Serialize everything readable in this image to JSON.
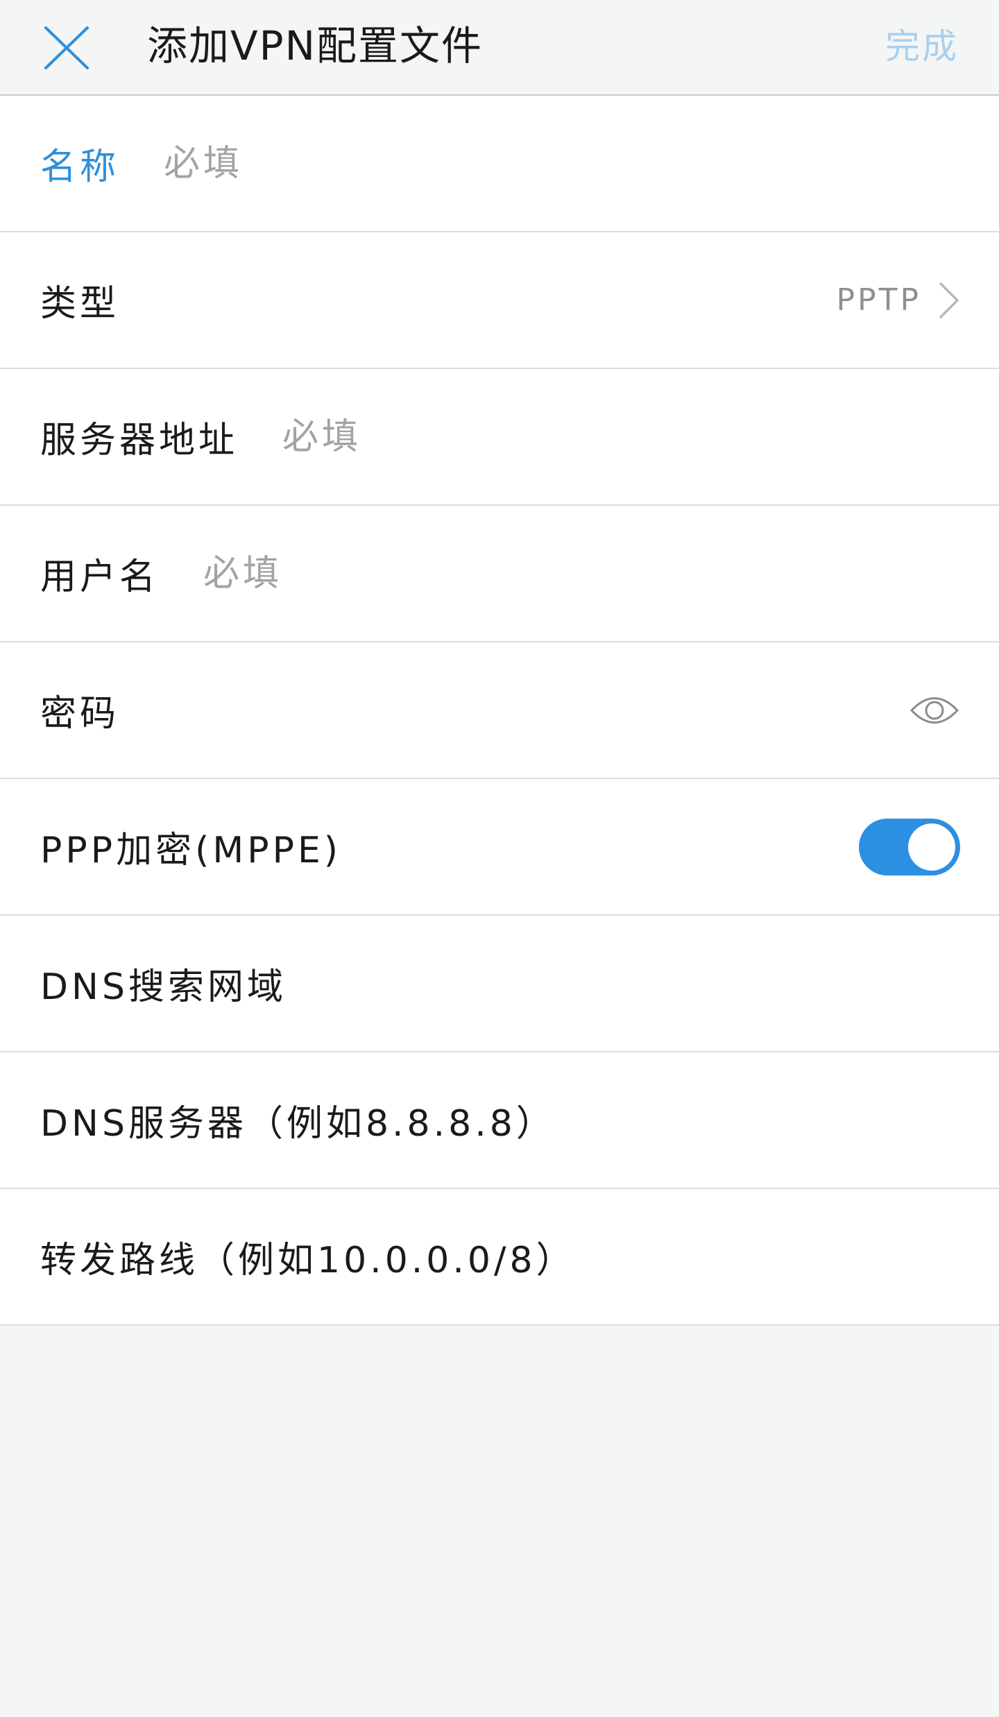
{
  "header": {
    "title": "添加VPN配置文件",
    "done_label": "完成",
    "close_icon": "close-icon"
  },
  "form": {
    "name": {
      "label": "名称",
      "placeholder": "必填"
    },
    "type": {
      "label": "类型",
      "value": "PPTP",
      "icon": "chevron-right-icon"
    },
    "server": {
      "label": "服务器地址",
      "placeholder": "必填"
    },
    "username": {
      "label": "用户名",
      "placeholder": "必填"
    },
    "password": {
      "label": "密码",
      "icon": "eye-icon"
    },
    "mppe": {
      "label": "PPP加密(MPPE)",
      "enabled": true
    },
    "dns_search": {
      "label": "DNS搜索网域"
    },
    "dns_server": {
      "label": "DNS服务器（例如8.8.8.8）"
    },
    "forward_route": {
      "label": "转发路线（例如10.0.0.0/8）"
    }
  },
  "colors": {
    "accent": "#2b8fe2",
    "label_active": "#2f8fd8",
    "done_disabled": "#a8d0ee",
    "placeholder": "#a3a3a3",
    "background": "#f4f5f5"
  }
}
